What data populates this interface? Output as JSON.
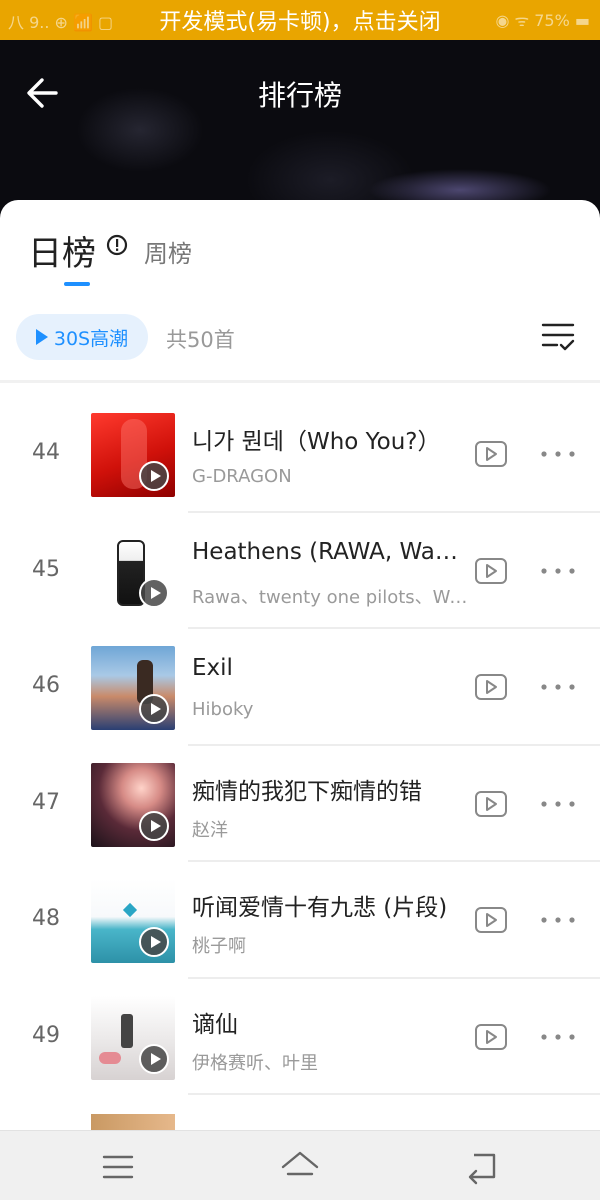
{
  "status_bar": {
    "banner_text": "开发模式(易卡顿)，点击关闭",
    "left_text": "八 9.. ⊕ 📶 ▢",
    "right_text": "◉ ᯤ 75% ▬"
  },
  "header": {
    "back_icon": "arrow-left-icon",
    "title": "排行榜"
  },
  "tabs": {
    "daily": "日榜",
    "weekly": "周榜",
    "info_icon": "info-circle-icon"
  },
  "toolbar": {
    "preview_label": "30S高潮",
    "song_count": "共50首",
    "multi_select_icon": "list-check-icon"
  },
  "songs": [
    {
      "rank": "44",
      "title": "니가 뭔데（Who You?）",
      "artist": "G-DRAGON"
    },
    {
      "rank": "45",
      "title": "Heathens (RAWA, Wang Remix)",
      "artist": "Rawa、twenty one pilots、Wang"
    },
    {
      "rank": "46",
      "title": "Exil",
      "artist": "Hiboky"
    },
    {
      "rank": "47",
      "title": "痴情的我犯下痴情的错",
      "artist": "赵洋"
    },
    {
      "rank": "48",
      "title": "听闻爱情十有九悲 (片段)",
      "artist": "桃子啊"
    },
    {
      "rank": "49",
      "title": "谪仙",
      "artist": "伊格赛听、叶里"
    }
  ],
  "row_icons": {
    "mv": "mv-play-icon",
    "more": "more-dots-icon",
    "cover_play": "play-icon"
  },
  "nav_bar": {
    "menu_icon": "menu-icon",
    "home_icon": "home-icon",
    "back_icon": "back-return-icon"
  },
  "colors": {
    "banner": "#e9a500",
    "accent": "#1e90ff",
    "preview_bg": "#e6f1fd"
  }
}
